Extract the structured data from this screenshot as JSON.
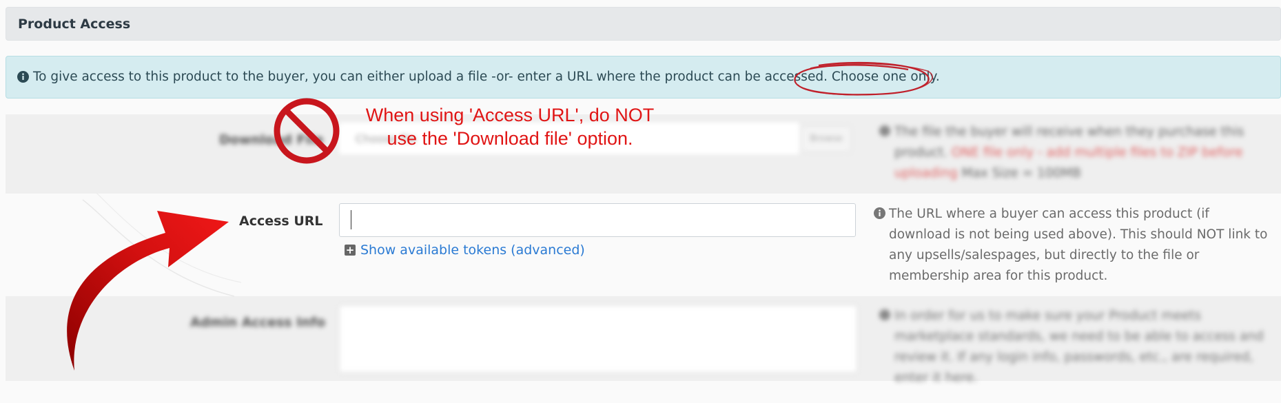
{
  "panel": {
    "title": "Product Access"
  },
  "alert": {
    "icon": "info-circle-icon",
    "text": "To give access to this product to the buyer, you can either upload a file -or- enter a URL where the product can be accessed. Choose one only."
  },
  "download_row": {
    "label": "Download File",
    "file_placeholder": "Choose file",
    "browse_label": "Browse",
    "help_part1": "The file the buyer will receive when they purchase this product. ",
    "help_red": "ONE file only - add multiple files to ZIP before uploading",
    "help_part2": " Max Size = 100MB"
  },
  "access_row": {
    "label": "Access URL",
    "input_value": "",
    "tokens_link": "Show available tokens (advanced)",
    "help": "The URL where a buyer can access this product (if download is not being used above). This should NOT link to any upsells/salespages, but directly to the file or membership area for this product."
  },
  "admin_row": {
    "label": "Admin Access Info",
    "textarea_value": "",
    "help": "In order for us to make sure your Product meets marketplace standards, we need to be able to access and review it. If any login info, passwords, etc., are required, enter it here."
  },
  "annotation": {
    "callout_line1": "When using 'Access URL', do NOT",
    "callout_line2": "use the 'Download file' option.",
    "color": "#e01414"
  }
}
